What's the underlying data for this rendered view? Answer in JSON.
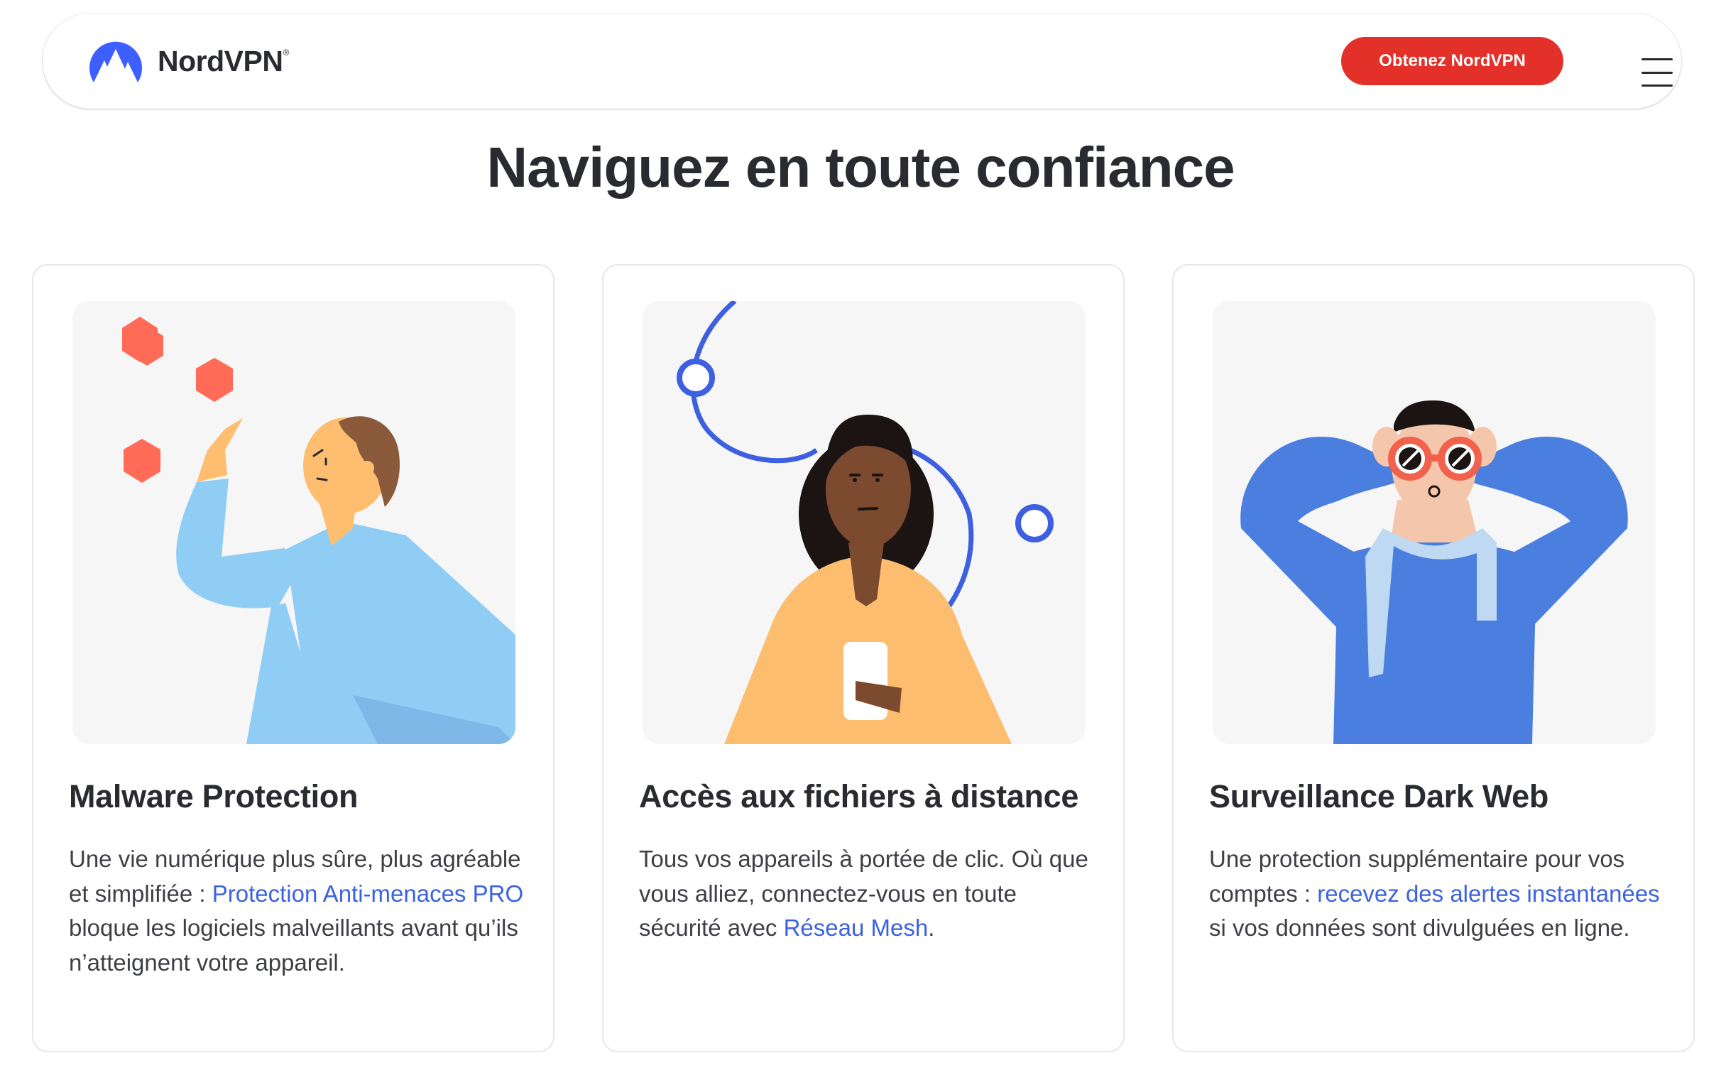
{
  "header": {
    "logo_text": "NordVPN",
    "logo_mark": "®",
    "cta_label": "Obtenez NordVPN",
    "menu_icon": "hamburger-menu-icon"
  },
  "page": {
    "title": "Naviguez en toute confiance"
  },
  "cards": [
    {
      "title": "Malware Protection",
      "body_before": "Une vie numérique plus sûre, plus agréable et simplifiée : ",
      "link": "Protection Anti-menaces PRO",
      "body_after": " bloque les logiciels malveillants avant qu’ils n’atteignent votre appareil.",
      "illustration": "man-blocking-malware-illustration"
    },
    {
      "title": "Accès aux fichiers à distance",
      "body_before": "Tous vos appareils à portée de clic. Où que vous alliez, connectez-vous en toute sécurité avec ",
      "link": "Réseau Mesh",
      "body_after": ".",
      "illustration": "woman-with-phone-network-illustration"
    },
    {
      "title": "Surveillance Dark Web",
      "body_before": "Une protection supplémentaire pour vos comptes : ",
      "link": "recevez des alertes instantanées",
      "body_after": " si vos données sont divulguées en ligne.",
      "illustration": "person-with-binoculars-illustration"
    }
  ],
  "colors": {
    "brand_red": "#e3312a",
    "link_blue": "#3b62e0",
    "logo_blue": "#3e5fff"
  }
}
